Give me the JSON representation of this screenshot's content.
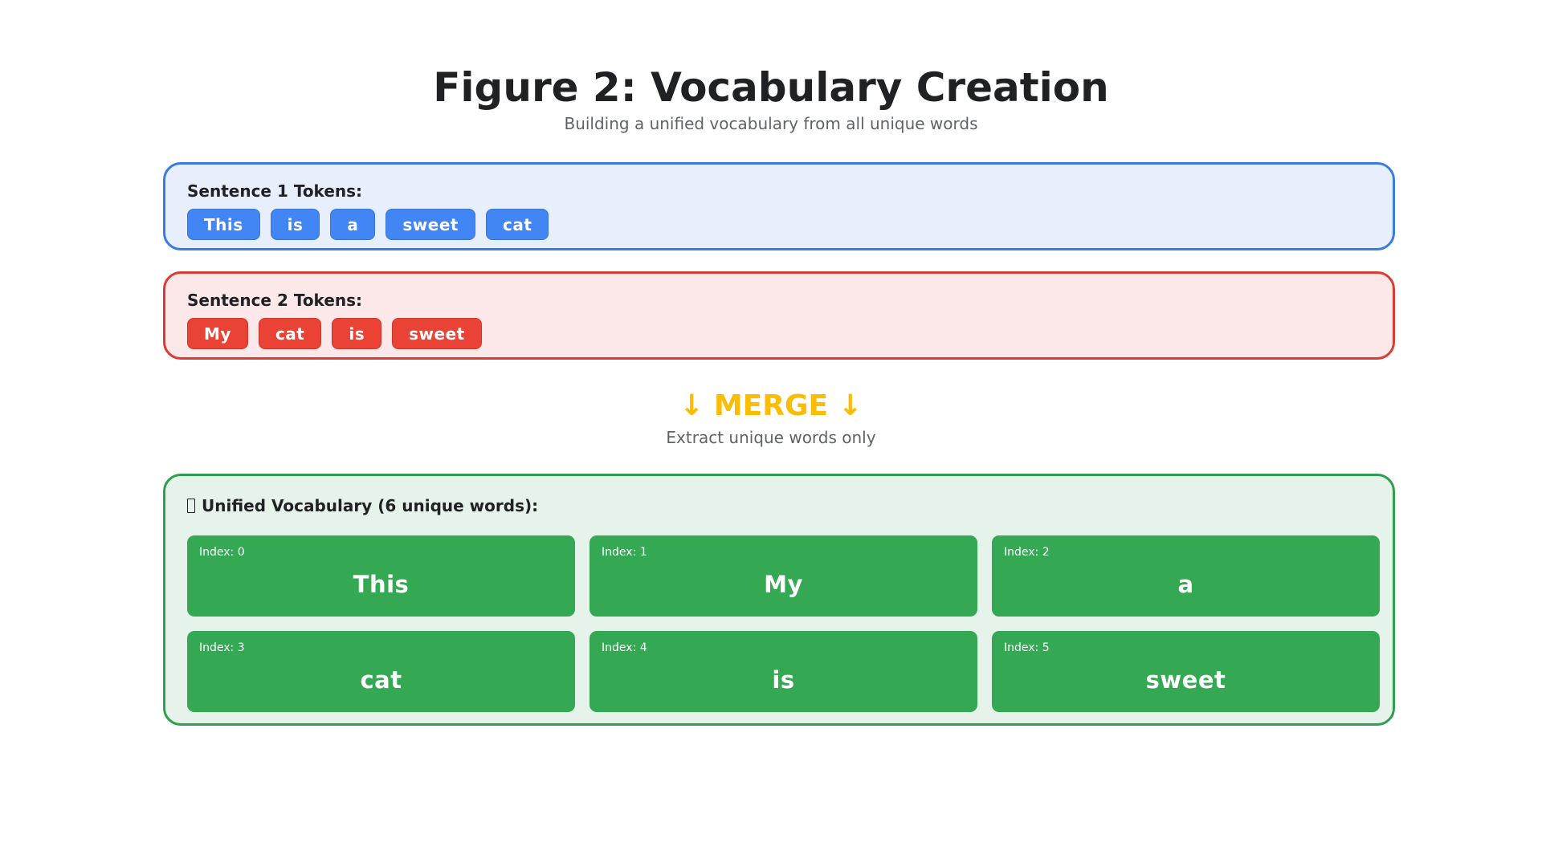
{
  "header": {
    "title": "Figure 2: Vocabulary Creation",
    "subtitle": "Building a unified vocabulary from all unique words"
  },
  "sentence1": {
    "label": "Sentence 1 Tokens:",
    "tokens": [
      "This",
      "is",
      "a",
      "sweet",
      "cat"
    ],
    "color": "#4285f4"
  },
  "sentence2": {
    "label": "Sentence 2 Tokens:",
    "tokens": [
      "My",
      "cat",
      "is",
      "sweet"
    ],
    "color": "#ea4335"
  },
  "merge": {
    "label": "↓ MERGE ↓",
    "caption": "Extract unique words only",
    "color": "#fbbc04"
  },
  "vocabulary": {
    "icon": "book-icon",
    "label": "Unified Vocabulary (6 unique words):",
    "color": "#34a853",
    "entries": [
      {
        "index_label": "Index: 0",
        "word": "This"
      },
      {
        "index_label": "Index: 1",
        "word": "My"
      },
      {
        "index_label": "Index: 2",
        "word": "a"
      },
      {
        "index_label": "Index: 3",
        "word": "cat"
      },
      {
        "index_label": "Index: 4",
        "word": "is"
      },
      {
        "index_label": "Index: 5",
        "word": "sweet"
      }
    ]
  }
}
